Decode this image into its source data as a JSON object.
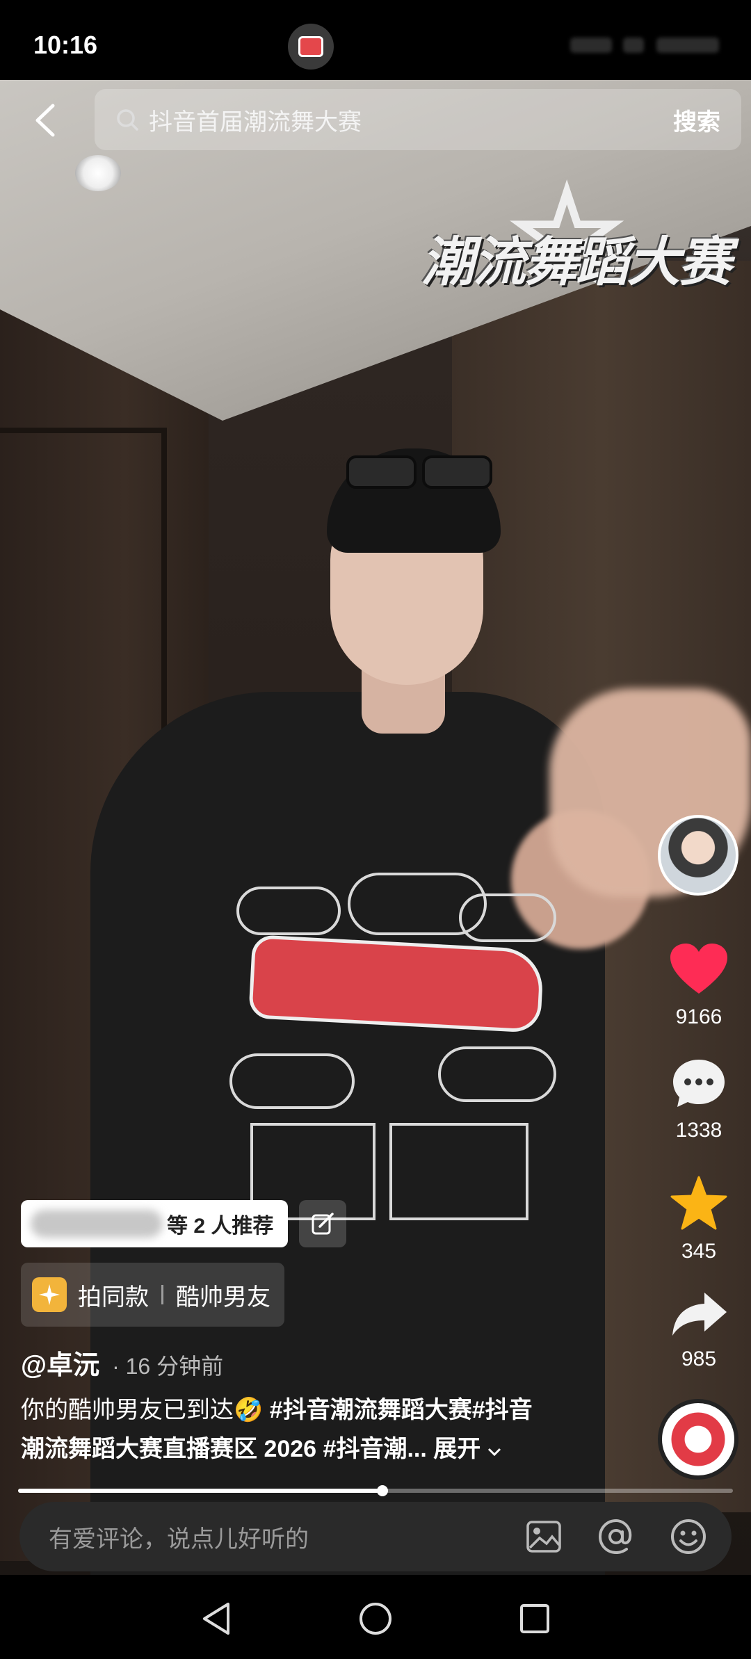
{
  "status_bar": {
    "time": "10:16"
  },
  "search": {
    "query": "抖音首届潮流舞大赛",
    "button_label": "搜索"
  },
  "video_overlay": {
    "title": "潮流舞蹈大赛"
  },
  "actions": {
    "likes": "9166",
    "comments": "1338",
    "favorites": "345",
    "shares": "985"
  },
  "recommendation": {
    "label": "等 2 人推荐"
  },
  "same_style": {
    "label": "拍同款",
    "name": "酷帅男友"
  },
  "post": {
    "author": "@卓沅",
    "time": "· 16 分钟前",
    "text_1": "你的酷帅男友已到达🤣 ",
    "tag_1": "#抖音潮流舞蹈大赛#抖音",
    "line_2": "潮流舞蹈大赛直播赛区 2026 ",
    "tag_2": "#抖音潮...",
    "expand": "展开"
  },
  "progress": {
    "fraction": 0.51
  },
  "comment_box": {
    "placeholder": "有爱评论，说点儿好听的"
  },
  "colors": {
    "like": "#fe2c55",
    "favorite": "#fbb415"
  }
}
